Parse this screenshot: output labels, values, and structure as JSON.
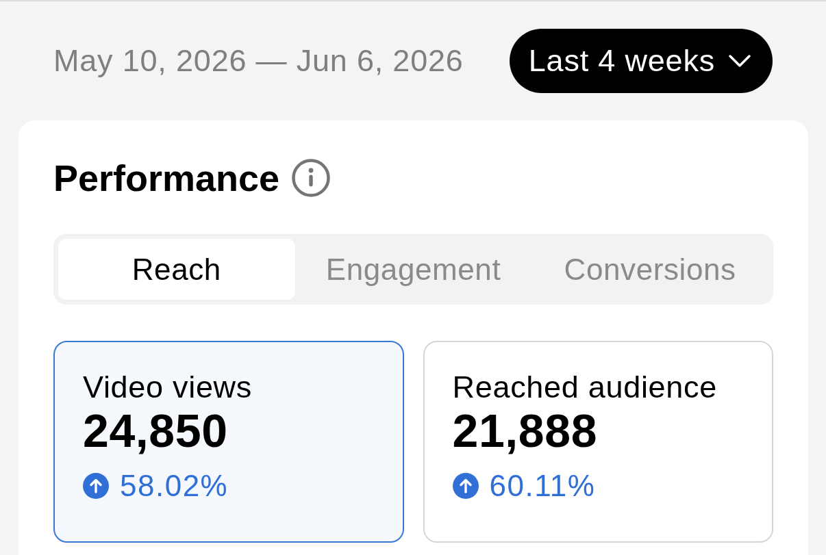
{
  "date_range": "May 10, 2026 — Jun 6, 2026",
  "period_dropdown": {
    "label": "Last 4 weeks"
  },
  "panel": {
    "title": "Performance",
    "tabs": [
      {
        "label": "Reach",
        "selected": true
      },
      {
        "label": "Engagement",
        "selected": false
      },
      {
        "label": "Conversions",
        "selected": false
      }
    ],
    "metrics": [
      {
        "label": "Video views",
        "value": "24,850",
        "change": "58.02%",
        "increase": true,
        "selected": true
      },
      {
        "label": "Reached audience",
        "value": "21,888",
        "change": "60.11%",
        "increase": true,
        "selected": false
      }
    ]
  }
}
